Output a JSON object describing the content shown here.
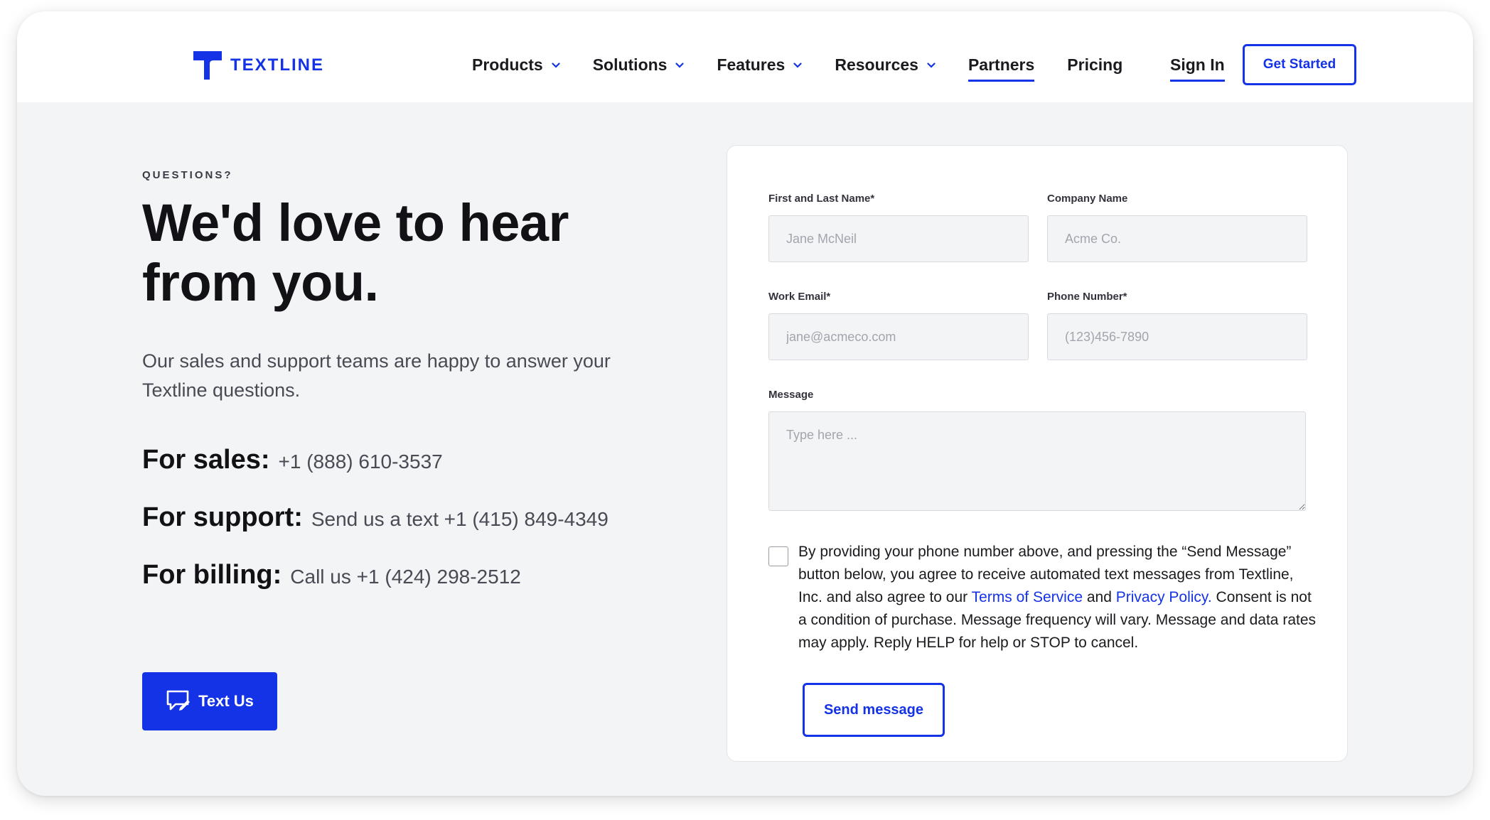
{
  "brand": {
    "name": "TEXTLINE",
    "color": "#1432e6"
  },
  "nav": {
    "items": [
      {
        "label": "Products",
        "dropdown": true
      },
      {
        "label": "Solutions",
        "dropdown": true
      },
      {
        "label": "Features",
        "dropdown": true
      },
      {
        "label": "Resources",
        "dropdown": true
      },
      {
        "label": "Partners",
        "dropdown": false
      },
      {
        "label": "Pricing",
        "dropdown": false
      }
    ],
    "sign_in": "Sign In",
    "get_started": "Get Started"
  },
  "hero": {
    "eyebrow": "QUESTIONS?",
    "headline": "We'd love to hear from you.",
    "lead": "Our sales and support teams are happy to answer your Textline questions.",
    "contacts": [
      {
        "label": "For sales:",
        "value": "+1 (888) 610-3537"
      },
      {
        "label": "For support:",
        "value": "Send us a text +1 (415) 849-4349"
      },
      {
        "label": "For billing:",
        "value": "Call us +1 (424) 298-2512"
      }
    ],
    "text_us_label": "Text Us"
  },
  "form": {
    "name": {
      "label": "First and Last Name*",
      "placeholder": "Jane McNeil",
      "value": ""
    },
    "company": {
      "label": "Company Name",
      "placeholder": "Acme Co.",
      "value": ""
    },
    "email": {
      "label": "Work Email*",
      "placeholder": "jane@acmeco.com",
      "value": ""
    },
    "phone": {
      "label": "Phone Number*",
      "placeholder": "(123)456-7890",
      "value": ""
    },
    "message": {
      "label": "Message",
      "placeholder": "Type here ...",
      "value": ""
    },
    "consent": {
      "checked": false,
      "text_before": "By providing your phone number above, and pressing the “Send Message” button below, you agree to receive automated text messages from Textline, Inc. and also agree to our ",
      "terms_link": "Terms of Service",
      "text_middle": " and ",
      "privacy_link": "Privacy Policy.",
      "text_after": " Consent is not a condition of purchase. Message frequency will vary. Message and data rates may apply. Reply HELP for help or STOP to cancel."
    },
    "submit_label": "Send message"
  }
}
